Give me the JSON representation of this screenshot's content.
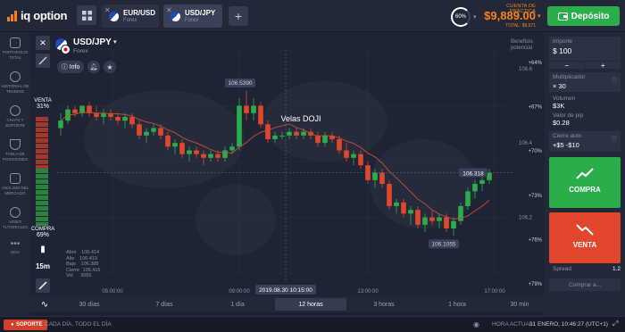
{
  "brand": {
    "name": "iq option"
  },
  "tabs": [
    {
      "name": "EUR/USD",
      "type": "Forex",
      "active": false
    },
    {
      "name": "USD/JPY",
      "type": "Forex",
      "active": true
    }
  ],
  "header": {
    "profit_percent": "60%",
    "account_label": "CUENTA DE PRÁCTICA",
    "balance": "$9,889.00",
    "total": "TOTAL: $9,971",
    "deposit_label": "Depósito"
  },
  "sidebar": {
    "items": [
      {
        "label": "PORTAFOLIO TOTAL",
        "icon": "briefcase-icon"
      },
      {
        "label": "HISTORIAL DE TRADING",
        "icon": "history-icon"
      },
      {
        "label": "CHATS Y SOPORTE",
        "icon": "chat-icon"
      },
      {
        "label": "TABLA DE POSICIONES",
        "icon": "trophy-icon"
      },
      {
        "label": "ANÁLISIS DEL MERCADO",
        "icon": "analysis-icon"
      },
      {
        "label": "VIDEO TUTORIALES",
        "icon": "play-icon"
      },
      {
        "label": "MÁS",
        "icon": "more-icon"
      }
    ]
  },
  "asset": {
    "name": "USD/JPY",
    "type": "Forex",
    "info_label": "Info",
    "profit_label": "Beneficio potencial"
  },
  "sentiment": {
    "sell_label": "VENTA",
    "sell_pct": "31%",
    "buy_label": "COMPRA",
    "buy_pct": "69%"
  },
  "chart_tools": {
    "timeframe": "15m"
  },
  "chart_data": {
    "type": "candlestick",
    "annotation": "Velas DOJI",
    "high_label": "106.5390",
    "low_label": "106.1055",
    "current_price": "106.318",
    "price_ticks": [
      "106.6",
      "106.4",
      "106.2"
    ],
    "pct_ticks": [
      "+64%",
      "+67%",
      "+70%",
      "+73%",
      "+76%",
      "+79%"
    ],
    "time_ticks": [
      "05:00:00",
      "09:00:00",
      "13:00:00",
      "17:00:00"
    ],
    "crosshair_time": "2019.08.30 10:15:00",
    "ohlc": {
      "labels": [
        "Abrir",
        "Alto",
        "Bajo",
        "Cierre",
        "Vol"
      ],
      "values": [
        "106.414",
        "106.419",
        "106.388",
        "106.416",
        "3055"
      ]
    },
    "ylim": [
      106.05,
      106.65
    ],
    "candles": [
      [
        106.44,
        106.48,
        106.42,
        106.46
      ],
      [
        106.46,
        106.5,
        106.45,
        106.49
      ],
      [
        106.49,
        106.5,
        106.47,
        106.48
      ],
      [
        106.48,
        106.5,
        106.47,
        106.5
      ],
      [
        106.5,
        106.51,
        106.47,
        106.48
      ],
      [
        106.48,
        106.5,
        106.46,
        106.47
      ],
      [
        106.47,
        106.49,
        106.45,
        106.48
      ],
      [
        106.48,
        106.49,
        106.46,
        106.47
      ],
      [
        106.47,
        106.48,
        106.45,
        106.46
      ],
      [
        106.46,
        106.48,
        106.44,
        106.47
      ],
      [
        106.47,
        106.48,
        106.44,
        106.45
      ],
      [
        106.45,
        106.46,
        106.41,
        106.42
      ],
      [
        106.42,
        106.44,
        106.4,
        106.43
      ],
      [
        106.43,
        106.45,
        106.42,
        106.44
      ],
      [
        106.44,
        106.45,
        106.41,
        106.42
      ],
      [
        106.42,
        106.43,
        106.38,
        106.39
      ],
      [
        106.39,
        106.41,
        106.37,
        106.4
      ],
      [
        106.4,
        106.41,
        106.36,
        106.37
      ],
      [
        106.37,
        106.39,
        106.35,
        106.38
      ],
      [
        106.38,
        106.39,
        106.36,
        106.37
      ],
      [
        106.37,
        106.38,
        106.34,
        106.36
      ],
      [
        106.36,
        106.38,
        106.35,
        106.37
      ],
      [
        106.37,
        106.38,
        106.35,
        106.36
      ],
      [
        106.36,
        106.39,
        106.35,
        106.38
      ],
      [
        106.38,
        106.4,
        106.37,
        106.39
      ],
      [
        106.39,
        106.52,
        106.38,
        106.5
      ],
      [
        106.5,
        106.54,
        106.46,
        106.48
      ],
      [
        106.48,
        106.52,
        106.46,
        106.5
      ],
      [
        106.5,
        106.51,
        106.44,
        106.45
      ],
      [
        106.45,
        106.46,
        106.4,
        106.41
      ],
      [
        106.41,
        106.43,
        106.4,
        106.42
      ],
      [
        106.42,
        106.43,
        106.41,
        106.42
      ],
      [
        106.42,
        106.44,
        106.41,
        106.43
      ],
      [
        106.43,
        106.44,
        106.41,
        106.42
      ],
      [
        106.42,
        106.44,
        106.41,
        106.43
      ],
      [
        106.43,
        106.44,
        106.41,
        106.42
      ],
      [
        106.42,
        106.43,
        106.39,
        106.4
      ],
      [
        106.4,
        106.43,
        106.39,
        106.42
      ],
      [
        106.42,
        106.43,
        106.4,
        106.41
      ],
      [
        106.41,
        106.42,
        106.37,
        106.38
      ],
      [
        106.38,
        106.4,
        106.35,
        106.36
      ],
      [
        106.36,
        106.38,
        106.34,
        106.37
      ],
      [
        106.37,
        106.38,
        106.33,
        106.34
      ],
      [
        106.34,
        106.35,
        106.29,
        106.3
      ],
      [
        106.3,
        106.33,
        106.28,
        106.32
      ],
      [
        106.32,
        106.33,
        106.28,
        106.29
      ],
      [
        106.29,
        106.3,
        106.22,
        106.23
      ],
      [
        106.23,
        106.25,
        106.21,
        106.24
      ],
      [
        106.24,
        106.25,
        106.2,
        106.21
      ],
      [
        106.21,
        106.23,
        106.18,
        106.22
      ],
      [
        106.22,
        106.23,
        106.17,
        106.18
      ],
      [
        106.18,
        106.21,
        106.16,
        106.2
      ],
      [
        106.2,
        106.22,
        106.18,
        106.19
      ],
      [
        106.19,
        106.21,
        106.17,
        106.2
      ],
      [
        106.2,
        106.21,
        106.16,
        106.17
      ],
      [
        106.17,
        106.2,
        106.15,
        106.19
      ],
      [
        106.19,
        106.24,
        106.18,
        106.23
      ],
      [
        106.23,
        106.28,
        106.22,
        106.27
      ],
      [
        106.27,
        106.3,
        106.25,
        106.29
      ],
      [
        106.29,
        106.31,
        106.27,
        106.3
      ],
      [
        106.3,
        106.33,
        106.29,
        106.32
      ]
    ]
  },
  "periods": [
    "30 días",
    "7 días",
    "1 día",
    "12 horas",
    "3 horas",
    "1 hora",
    "30 min"
  ],
  "active_period": "12 horas",
  "right_panel": {
    "amount_label": "Importe",
    "amount_value": "$ 100",
    "multiplier_label": "Multiplicador",
    "multiplier_value": "× 30",
    "volume_label": "Volumen",
    "volume_value": "$3K",
    "pip_label": "Valor de pip",
    "pip_value": "$0.28",
    "auto_close_label": "Cierre auto",
    "auto_close_value": "+$5 -$10",
    "buy_label": "COMPRA",
    "sell_label": "VENTA",
    "spread_label": "Spread",
    "spread_value": "1.2",
    "buy_at_label": "Comprar a..."
  },
  "footer": {
    "support_label": "SOPORTE",
    "tagline": "CADA DÍA, TODO EL DÍA",
    "time_label": "HORA ACTUAL:",
    "time_value": "31 ENERO, 10:46:27 (UTC+1)"
  },
  "colors": {
    "up": "#2cad4b",
    "down": "#e2462d",
    "accent": "#f6821f",
    "ma": "#c4503a"
  }
}
